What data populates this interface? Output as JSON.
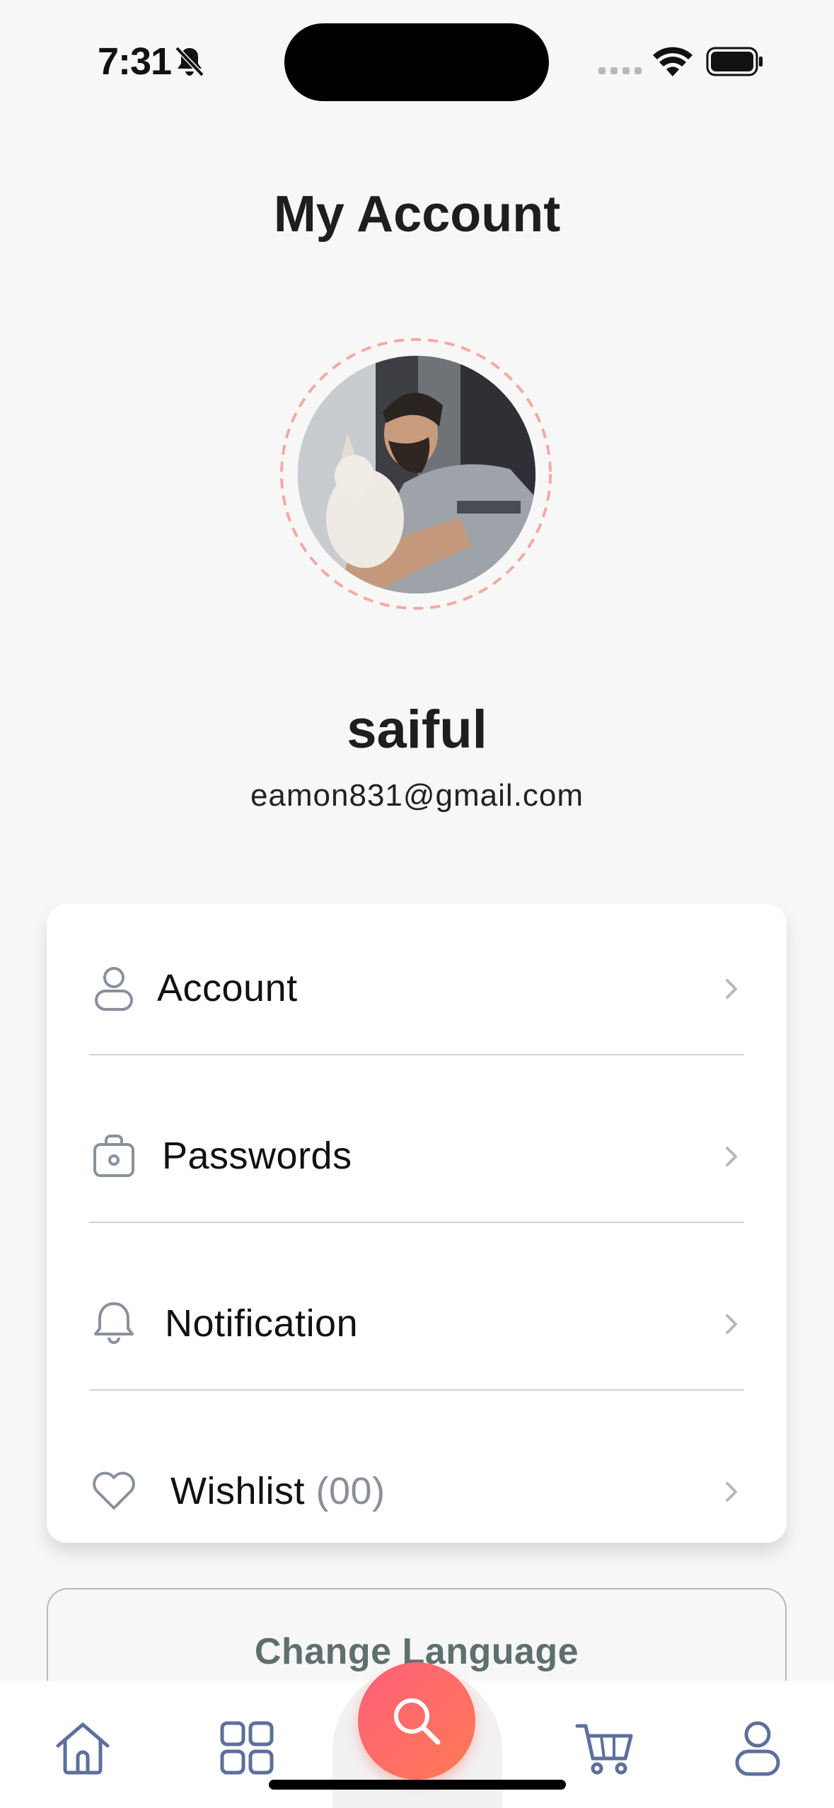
{
  "status_bar": {
    "time": "7:31",
    "icons": [
      "bell-slash-icon",
      "cellular-signal-icon",
      "wifi-icon",
      "battery-icon"
    ]
  },
  "header": {
    "title": "My Account"
  },
  "profile": {
    "name": "saiful",
    "email": "eamon831@gmail.com",
    "ring_color": "#f4a9a3"
  },
  "menu": {
    "items": [
      {
        "label": "Account",
        "icon": "user-icon"
      },
      {
        "label": "Passwords",
        "icon": "lock-bag-icon"
      },
      {
        "label": "Notification",
        "icon": "bell-icon"
      },
      {
        "label": "Wishlist",
        "count": "(00)",
        "icon": "heart-icon"
      }
    ]
  },
  "change_language": {
    "label": "Change Language"
  },
  "tab_bar": {
    "items": [
      "home-icon",
      "grid-icon",
      "search-icon",
      "cart-icon",
      "profile-icon"
    ],
    "accent": "#ff6b6b",
    "icon_color": "#5d6f9c"
  }
}
